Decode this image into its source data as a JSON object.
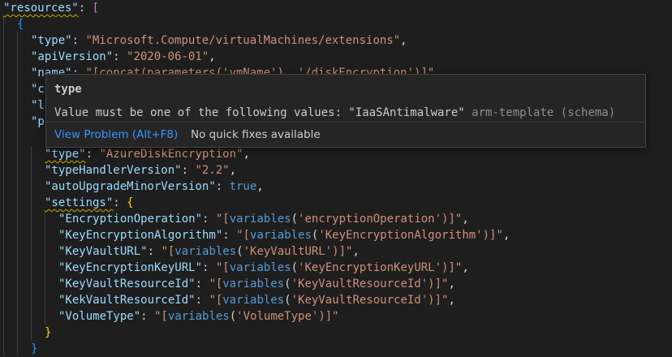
{
  "editor": {
    "lines": [
      {
        "row": 0,
        "indent": 0,
        "tokens": [
          {
            "t": "\"resources\"",
            "c": "k",
            "sq": true
          },
          {
            "t": ": ",
            "c": "p"
          },
          {
            "t": "[",
            "c": "b"
          }
        ]
      },
      {
        "row": 1,
        "indent": 1,
        "tokens": [
          {
            "t": "{",
            "c": "bb"
          }
        ]
      },
      {
        "row": 2,
        "indent": 2,
        "tokens": [
          {
            "t": "\"type\"",
            "c": "k"
          },
          {
            "t": ": ",
            "c": "p"
          },
          {
            "t": "\"Microsoft.Compute/virtualMachines/extensions\"",
            "c": "s"
          },
          {
            "t": ",",
            "c": "p"
          }
        ]
      },
      {
        "row": 3,
        "indent": 2,
        "tokens": [
          {
            "t": "\"apiVersion\"",
            "c": "k"
          },
          {
            "t": ": ",
            "c": "p"
          },
          {
            "t": "\"2020-06-01\"",
            "c": "s"
          },
          {
            "t": ",",
            "c": "p"
          }
        ]
      },
      {
        "row": 4,
        "indent": 2,
        "tokens": [
          {
            "t": "\"name\"",
            "c": "k"
          },
          {
            "t": ": ",
            "c": "p"
          },
          {
            "t": "\"[concat(parameters('vmName'), '/diskEncryption')]\"",
            "c": "s"
          },
          {
            "t": ",",
            "c": "p"
          }
        ]
      },
      {
        "row": 5,
        "indent": 2,
        "tokens": [
          {
            "t": "\"c",
            "c": "k"
          }
        ]
      },
      {
        "row": 6,
        "indent": 2,
        "tokens": [
          {
            "t": "\"l",
            "c": "k"
          }
        ]
      },
      {
        "row": 7,
        "indent": 2,
        "tokens": [
          {
            "t": "\"p",
            "c": "k"
          }
        ]
      },
      {
        "row": 9,
        "indent": 3,
        "tokens": [
          {
            "t": "\"type\"",
            "c": "k",
            "sq": true
          },
          {
            "t": ": ",
            "c": "p"
          },
          {
            "t": "\"AzureDiskEncryption\"",
            "c": "s"
          },
          {
            "t": ",",
            "c": "p"
          }
        ]
      },
      {
        "row": 10,
        "indent": 3,
        "tokens": [
          {
            "t": "\"typeHandlerVersion\"",
            "c": "k"
          },
          {
            "t": ": ",
            "c": "p"
          },
          {
            "t": "\"2.2\"",
            "c": "s"
          },
          {
            "t": ",",
            "c": "p"
          }
        ]
      },
      {
        "row": 11,
        "indent": 3,
        "tokens": [
          {
            "t": "\"autoUpgradeMinorVersion\"",
            "c": "k"
          },
          {
            "t": ": ",
            "c": "p"
          },
          {
            "t": "true",
            "c": "kw"
          },
          {
            "t": ",",
            "c": "p"
          }
        ]
      },
      {
        "row": 12,
        "indent": 3,
        "tokens": [
          {
            "t": "\"settings\"",
            "c": "k",
            "sq": true
          },
          {
            "t": ": ",
            "c": "p"
          },
          {
            "t": "{",
            "c": "gb"
          }
        ]
      },
      {
        "row": 13,
        "indent": 4,
        "tokens": [
          {
            "t": "\"EncryptionOperation\"",
            "c": "k"
          },
          {
            "t": ": ",
            "c": "p"
          },
          {
            "t": "\"[",
            "c": "s"
          },
          {
            "t": "variables",
            "c": "kw"
          },
          {
            "t": "(",
            "c": "p"
          },
          {
            "t": "'encryptionOperation'",
            "c": "s"
          },
          {
            "t": ")]\"",
            "c": "s"
          },
          {
            "t": ",",
            "c": "p"
          }
        ]
      },
      {
        "row": 14,
        "indent": 4,
        "tokens": [
          {
            "t": "\"KeyEncryptionAlgorithm\"",
            "c": "k"
          },
          {
            "t": ": ",
            "c": "p"
          },
          {
            "t": "\"[",
            "c": "s"
          },
          {
            "t": "variables",
            "c": "kw"
          },
          {
            "t": "(",
            "c": "p"
          },
          {
            "t": "'KeyEncryptionAlgorithm'",
            "c": "s"
          },
          {
            "t": ")]\"",
            "c": "s"
          },
          {
            "t": ",",
            "c": "p"
          }
        ]
      },
      {
        "row": 15,
        "indent": 4,
        "tokens": [
          {
            "t": "\"KeyVaultURL\"",
            "c": "k"
          },
          {
            "t": ": ",
            "c": "p"
          },
          {
            "t": "\"[",
            "c": "s"
          },
          {
            "t": "variables",
            "c": "kw"
          },
          {
            "t": "(",
            "c": "p"
          },
          {
            "t": "'KeyVaultURL'",
            "c": "s"
          },
          {
            "t": ")]\"",
            "c": "s"
          },
          {
            "t": ",",
            "c": "p"
          }
        ]
      },
      {
        "row": 16,
        "indent": 4,
        "tokens": [
          {
            "t": "\"KeyEncryptionKeyURL\"",
            "c": "k"
          },
          {
            "t": ": ",
            "c": "p"
          },
          {
            "t": "\"[",
            "c": "s"
          },
          {
            "t": "variables",
            "c": "kw"
          },
          {
            "t": "(",
            "c": "p"
          },
          {
            "t": "'KeyEncryptionKeyURL'",
            "c": "s"
          },
          {
            "t": ")]\"",
            "c": "s"
          },
          {
            "t": ",",
            "c": "p"
          }
        ]
      },
      {
        "row": 17,
        "indent": 4,
        "tokens": [
          {
            "t": "\"KeyVaultResourceId\"",
            "c": "k"
          },
          {
            "t": ": ",
            "c": "p"
          },
          {
            "t": "\"[",
            "c": "s"
          },
          {
            "t": "variables",
            "c": "kw"
          },
          {
            "t": "(",
            "c": "p"
          },
          {
            "t": "'KeyVaultResourceId'",
            "c": "s"
          },
          {
            "t": ")]\"",
            "c": "s"
          },
          {
            "t": ",",
            "c": "p"
          }
        ]
      },
      {
        "row": 18,
        "indent": 4,
        "tokens": [
          {
            "t": "\"KekVaultResourceId\"",
            "c": "k"
          },
          {
            "t": ": ",
            "c": "p"
          },
          {
            "t": "\"[",
            "c": "s"
          },
          {
            "t": "variables",
            "c": "kw"
          },
          {
            "t": "(",
            "c": "p"
          },
          {
            "t": "'KeyVaultResourceId'",
            "c": "s"
          },
          {
            "t": ")]\"",
            "c": "s"
          },
          {
            "t": ",",
            "c": "p"
          }
        ]
      },
      {
        "row": 19,
        "indent": 4,
        "tokens": [
          {
            "t": "\"VolumeType\"",
            "c": "k"
          },
          {
            "t": ": ",
            "c": "p"
          },
          {
            "t": "\"[",
            "c": "s"
          },
          {
            "t": "variables",
            "c": "kw"
          },
          {
            "t": "(",
            "c": "p"
          },
          {
            "t": "'VolumeType'",
            "c": "s"
          },
          {
            "t": ")]\"",
            "c": "s"
          }
        ]
      },
      {
        "row": 20,
        "indent": 3,
        "tokens": [
          {
            "t": "}",
            "c": "gb"
          }
        ]
      },
      {
        "row": 21,
        "indent": 2,
        "tokens": [
          {
            "t": "}",
            "c": "bb"
          }
        ]
      }
    ]
  },
  "hover": {
    "title": "type",
    "message": "Value must be one of the following values: \"IaaSAntimalware\" ",
    "source": "arm-template (schema)",
    "view_problem": "View Problem (Alt+F8)",
    "no_fixes": "No quick fixes available"
  }
}
